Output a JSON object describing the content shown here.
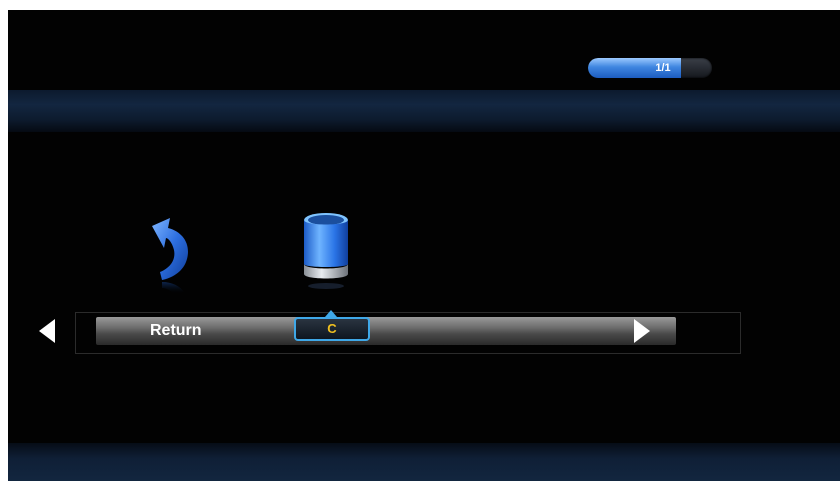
{
  "page_indicator": {
    "text": "1/1",
    "fill_fraction": 0.75
  },
  "icons": [
    {
      "name": "return-arrow-icon",
      "selected": false
    },
    {
      "name": "trash-bin-icon",
      "selected": true
    }
  ],
  "menu": {
    "left_nav": "left-arrow-icon",
    "label": "Return",
    "key_hint": "C",
    "right_nav": "right-arrow-icon"
  },
  "colors": {
    "background": "#020202",
    "accent_blue": "#3f86e0",
    "key_hint_text": "#f0c020",
    "key_hint_border": "#3fa8e8"
  }
}
